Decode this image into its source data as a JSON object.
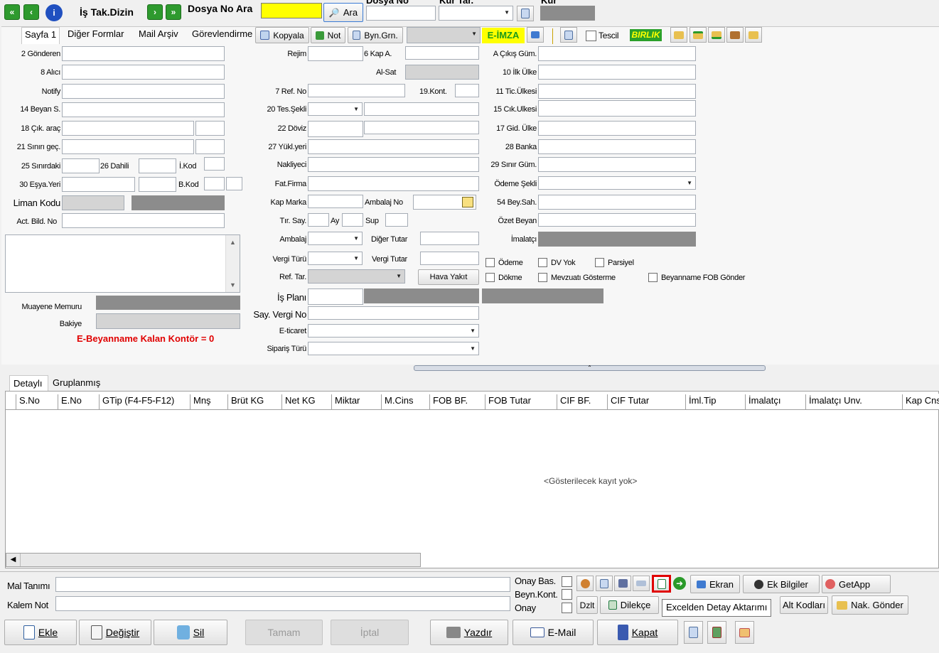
{
  "toolbar": {
    "is_tak_dizin": "İş Tak.Dizin",
    "dosya_no_ara_label": "Dosya No Ara",
    "ara_button": "Ara",
    "dosya_no_label": "Dosya No",
    "kur_tar_label": "Kur Tar.",
    "kur_label": "Kur"
  },
  "tabs": [
    "Sayfa 1",
    "Diğer Formlar",
    "Mail Arşiv",
    "Görevlendirme"
  ],
  "tab_buttons": {
    "kopyala": "Kopyala",
    "not": "Not",
    "byn_grn": "Byn.Grn.",
    "e_imza": "E-İMZA",
    "tescil": "Tescil",
    "birlik": "BIRLIK"
  },
  "left_fields": {
    "gonderen": "2 Gönderen",
    "alici": "8 Alıcı",
    "notify": "Notify",
    "beyan_s": "14 Beyan S.",
    "cik_arac": "18 Çık. araç",
    "sinir_gec": "21 Sınırı geç.",
    "sinirdaki": "25 Sınırdaki",
    "dahili": "26 Dahili",
    "i_kod": "İ.Kod",
    "esya_yeri": "30 Eşya.Yeri",
    "b_kod": "B.Kod",
    "liman_kodu": "Liman Kodu",
    "act_bild_no": "Act. Bild. No",
    "muayene_memuru": "Muayene Memuru",
    "bakiye": "Bakiye",
    "kontor": "E-Beyanname Kalan Kontör = 0"
  },
  "mid_fields": {
    "rejim": "Rejim",
    "kap_a": "6 Kap A.",
    "al_sat": "Al-Sat",
    "ref_no": "7 Ref. No",
    "kont": "19.Kont.",
    "tes_sekli": "20 Tes.Şekli",
    "doviz": "22 Döviz",
    "yukl_yeri": "27 Yükl.yeri",
    "nakliyeci": "Nakliyeci",
    "fat_firma": "Fat.Firma",
    "kap_marka": "Kap Marka",
    "ambalaj_no": "Ambalaj No",
    "tir_say": "Tır. Say.",
    "ay": "Ay",
    "sup": "Sup",
    "ambalaj": "Ambalaj",
    "diger_tutar": "Diğer Tutar",
    "vergi_turu": "Vergi Türü",
    "vergi_tutar": "Vergi Tutar",
    "ref_tar": "Ref. Tar.",
    "hava_yakit": "Hava Yakıt",
    "is_plani": "İş Planı",
    "say_vergi_no": "Say. Vergi No",
    "e_ticaret": "E-ticaret",
    "siparis_turu": "Sipariş Türü"
  },
  "right_fields": {
    "cikis_gum": "A Çıkış Güm.",
    "ilk_ulke": "10 İlk Ülke",
    "tic_ulkesi": "11 Tic.Ülkesi",
    "cik_ulkesi": "15 Cık.Ulkesi",
    "gid_ulke": "17 Gid. Ülke",
    "banka": "28 Banka",
    "sinir_gum": "29 Sınır Güm.",
    "odeme_sekli": "Ödeme Şekli",
    "bey_sah": "54 Bey.Sah.",
    "ozet_beyan": "Özet Beyan",
    "imalatci": "İmalatçı",
    "cb_odeme": "Ödeme",
    "cb_dv_yok": "DV Yok",
    "cb_parsiyel": "Parsiyel",
    "cb_dokme": "Dökme",
    "cb_mevzuati": "Mevzuatı Gösterme",
    "cb_fob": "Beyanname FOB Gönder"
  },
  "grid": {
    "tabs": [
      "Detaylı",
      "Gruplanmış"
    ],
    "columns": [
      "S.No",
      "E.No",
      "GTip (F4-F5-F12)",
      "Mnş",
      "Brüt KG",
      "Net KG",
      "Miktar",
      "M.Cins",
      "FOB BF.",
      "FOB Tutar",
      "CIF BF.",
      "CIF Tutar",
      "İml.Tip",
      "İmalatçı",
      "İmalatçı Unv.",
      "Kap Cns"
    ],
    "empty_text": "<Gösterilecek kayıt yok>"
  },
  "detail": {
    "mal_tanimi": "Mal Tanımı",
    "kalem_not": "Kalem Not",
    "onay_bas": "Onay Bas.",
    "beyn_kont": "Beyn.Kont.",
    "onay": "Onay",
    "ekran": "Ekran",
    "ek_bilgiler": "Ek Bilgiler",
    "getapp": "GetApp",
    "dzlt": "Dzlt",
    "dilekce": "Dilekçe",
    "alt_kodlari": "Alt Kodları",
    "nak_gonder": "Nak. Gönder",
    "tooltip": "Excelden Detay Aktarımı"
  },
  "bottom": {
    "ekle": "Ekle",
    "degistir": "Değiştir",
    "sil": "Sil",
    "tamam": "Tamam",
    "iptal": "İptal",
    "yazdir": "Yazdır",
    "email": "E-Mail",
    "kapat": "Kapat"
  },
  "colors": {
    "highlight": "#ffff00",
    "alert_red": "#e00000",
    "tooltip_outline": "#e00000",
    "birlik_green": "#2aa02a"
  }
}
